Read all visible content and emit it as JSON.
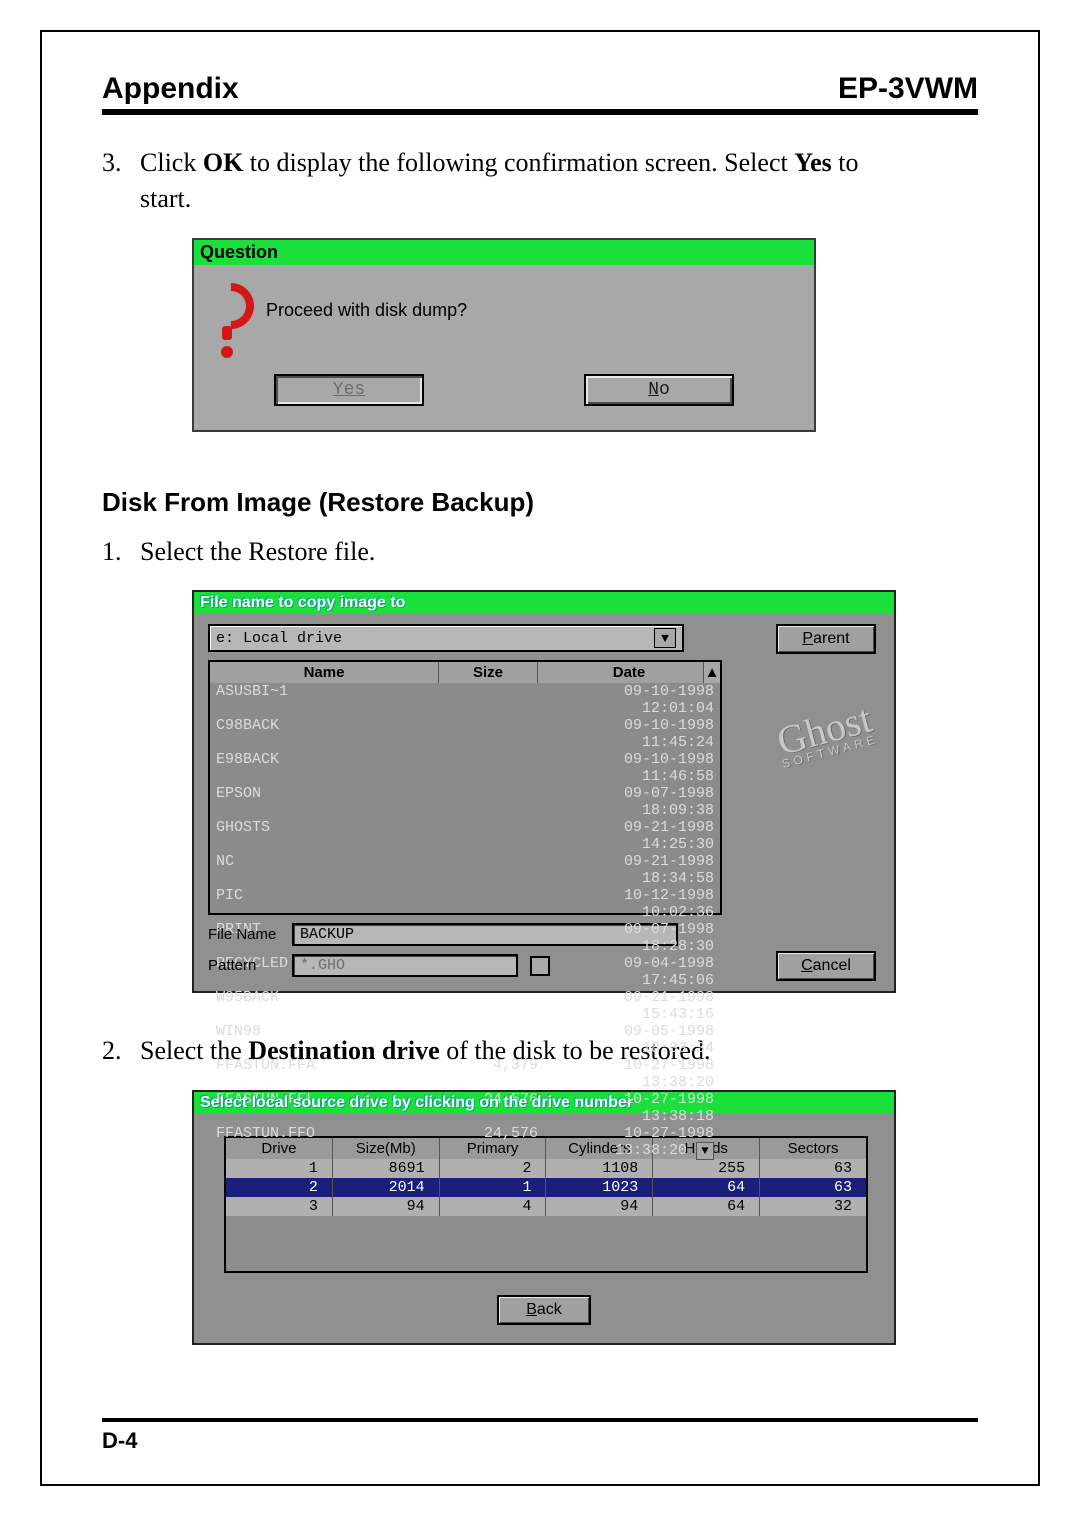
{
  "header": {
    "left": "Appendix",
    "right": "EP-3VWM"
  },
  "footer": "D-4",
  "step3": {
    "num": "3.",
    "text_a": "Click ",
    "ok": "OK",
    "text_b": " to display the following confirmation screen.  Select ",
    "yes": "Yes",
    "text_c": " to",
    "line2": "start."
  },
  "dlg1": {
    "title": "Question",
    "message": "Proceed with disk dump?",
    "btn_yes": "Yes",
    "btn_no_u": "N",
    "btn_no_rest": "o"
  },
  "section_title": "Disk From Image (Restore Backup)",
  "step1": {
    "num": "1.",
    "text": "Select the Restore file."
  },
  "dlg2": {
    "title": "File name to copy image to",
    "drive": "e: Local drive",
    "cols": {
      "name": "Name",
      "size": "Size",
      "date": "Date"
    },
    "rows": [
      {
        "n": "ASUSBI~1",
        "s": "",
        "d": "09-10-1998 12:01:04"
      },
      {
        "n": "C98BACK",
        "s": "",
        "d": "09-10-1998 11:45:24"
      },
      {
        "n": "E98BACK",
        "s": "",
        "d": "09-10-1998 11:46:58"
      },
      {
        "n": "EPSON",
        "s": "",
        "d": "09-07-1998 18:09:38"
      },
      {
        "n": "GHOSTS",
        "s": "",
        "d": "09-21-1998 14:25:30"
      },
      {
        "n": "NC",
        "s": "",
        "d": "09-21-1998 18:34:58"
      },
      {
        "n": "PIC",
        "s": "",
        "d": "10-12-1998 10:02:36"
      },
      {
        "n": "PRINT",
        "s": "",
        "d": "09-07-1998 18:28:30"
      },
      {
        "n": "RECYCLED",
        "s": "",
        "d": "09-04-1998 17:45:06"
      },
      {
        "n": "W95BACK",
        "s": "",
        "d": "09-21-1998 15:43:16"
      },
      {
        "n": "WIN98",
        "s": "",
        "d": "09-05-1998 18:33:34"
      },
      {
        "n": "FFASTUN.FFA",
        "s": "4,379",
        "d": "10-27-1998 13:38:20"
      },
      {
        "n": "FFASTUN.FFL",
        "s": "24,576",
        "d": "10-27-1998 13:38:18"
      },
      {
        "n": "FFASTUN.FFO",
        "s": "24,576",
        "d": "10-27-1998 13:38:20"
      }
    ],
    "filename_label": "File Name",
    "filename_value": "BACKUP",
    "pattern_label": "Pattern",
    "pattern_value": "*.GHO",
    "parent_u": "P",
    "parent_rest": "arent",
    "cancel_u": "C",
    "cancel_rest": "ancel",
    "logo": "Ghost",
    "logo_sub": "SOFTWARE"
  },
  "step2": {
    "num": "2.",
    "text_a": "Select the ",
    "bold": "Destination drive",
    "text_b": " of the disk to be restored."
  },
  "dlg3": {
    "title": "Select local source drive by clicking on the drive number",
    "cols": [
      "Drive",
      "Size(Mb)",
      "Primary",
      "Cylinders",
      "Heads",
      "Sectors"
    ],
    "rows": [
      [
        "1",
        "8691",
        "2",
        "1108",
        "255",
        "63"
      ],
      [
        "2",
        "2014",
        "1",
        "1023",
        "64",
        "63"
      ],
      [
        "3",
        "94",
        "4",
        "94",
        "64",
        "32"
      ]
    ],
    "selected": 1,
    "back_u": "B",
    "back_rest": "ack"
  }
}
